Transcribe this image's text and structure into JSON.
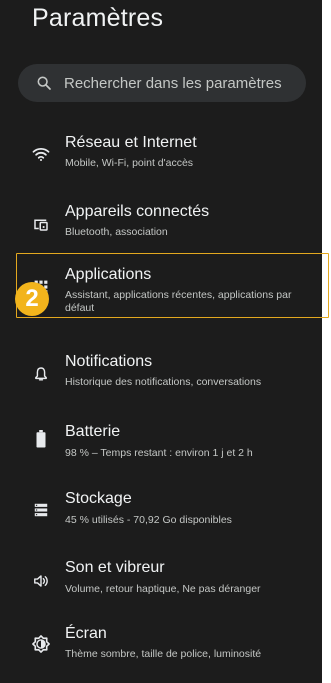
{
  "header": {
    "title": "Paramètres"
  },
  "search": {
    "placeholder": "Rechercher dans les paramètres"
  },
  "settings": {
    "items": [
      {
        "label": "Réseau et Internet",
        "subtitle": "Mobile, Wi-Fi, point d'accès",
        "icon": "wifi-icon"
      },
      {
        "label": "Appareils connectés",
        "subtitle": "Bluetooth, association",
        "icon": "connected-devices-icon"
      },
      {
        "label": "Applications",
        "subtitle": "Assistant, applications récentes, applications par défaut",
        "icon": "apps-grid-icon"
      },
      {
        "label": "Notifications",
        "subtitle": "Historique des notifications, conversations",
        "icon": "bell-icon"
      },
      {
        "label": "Batterie",
        "subtitle": "98 % – Temps restant : environ 1 j et 2 h",
        "icon": "battery-icon"
      },
      {
        "label": "Stockage",
        "subtitle": "45 % utilisés - 70,92 Go disponibles",
        "icon": "storage-icon"
      },
      {
        "label": "Son et vibreur",
        "subtitle": "Volume, retour haptique, Ne pas déranger",
        "icon": "volume-icon"
      },
      {
        "label": "Écran",
        "subtitle": "Thème sombre, taille de police, luminosité",
        "icon": "brightness-icon"
      }
    ]
  },
  "annotation": {
    "step": "2"
  },
  "colors": {
    "background": "#1c1c1c",
    "search_background": "#2f3133",
    "highlight": "#e3a81f",
    "badge": "#f2b41c",
    "text_primary": "#f1f3f4",
    "text_secondary": "#c4c7c5"
  }
}
